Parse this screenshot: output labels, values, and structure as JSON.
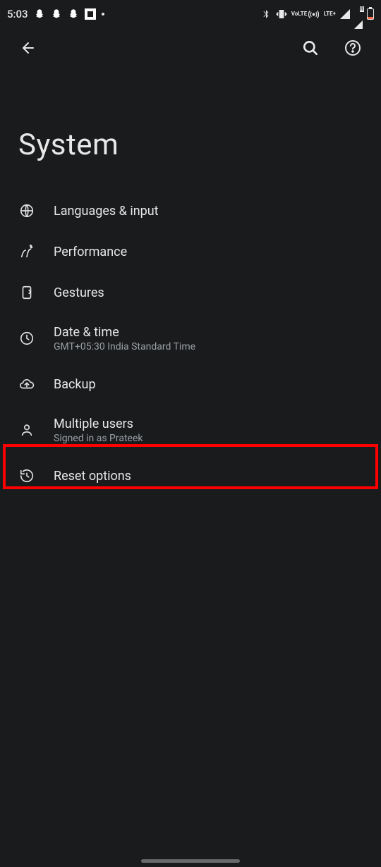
{
  "status_bar": {
    "time": "5:03",
    "lte_label": "LTE+",
    "volte_label": "VoLTE"
  },
  "toolbar": {},
  "page": {
    "title": "System"
  },
  "items": [
    {
      "title": "Languages & input",
      "sub": ""
    },
    {
      "title": "Performance",
      "sub": ""
    },
    {
      "title": "Gestures",
      "sub": ""
    },
    {
      "title": "Date & time",
      "sub": "GMT+05:30 India Standard Time"
    },
    {
      "title": "Backup",
      "sub": ""
    },
    {
      "title": "Multiple users",
      "sub": "Signed in as Prateek"
    },
    {
      "title": "Reset options",
      "sub": ""
    }
  ]
}
